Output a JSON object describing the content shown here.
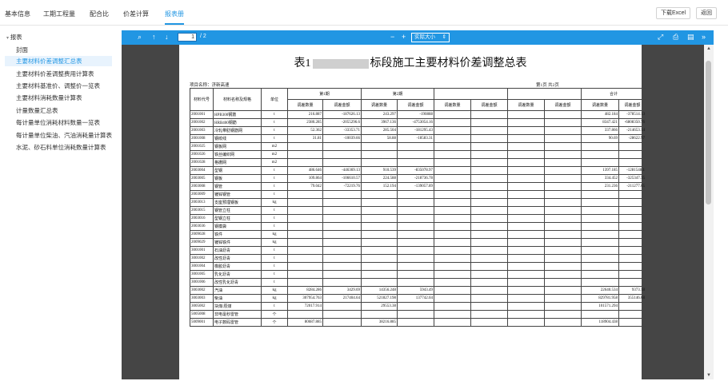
{
  "tabs": [
    {
      "label": "基本信息",
      "active": false
    },
    {
      "label": "工期工程量",
      "active": false
    },
    {
      "label": "配合比",
      "active": false
    },
    {
      "label": "价差计算",
      "active": false
    },
    {
      "label": "报表册",
      "active": true
    }
  ],
  "actions": {
    "download": "下载Excel",
    "back": "返回"
  },
  "sidebar": {
    "root": "报表",
    "items": [
      {
        "label": "封面"
      },
      {
        "label": "主要材料价差调整汇总表",
        "active": true
      },
      {
        "label": "主要材料价差调整费用计算表"
      },
      {
        "label": "主要材料基准价、调整价一览表"
      },
      {
        "label": "主要材料消耗数量计算表"
      },
      {
        "label": "计量数量汇总表"
      },
      {
        "label": "每计量单位消耗材料数量一览表"
      },
      {
        "label": "每计量单位柴油、汽油消耗量计算表"
      },
      {
        "label": "水泥、砂石料单位消耗数量计算表"
      }
    ]
  },
  "viewer": {
    "page_current": "1",
    "page_total": "/ 2",
    "zoom": "实际大小",
    "icons": {
      "search": "search-icon",
      "prev": "arrow-up-icon",
      "next": "arrow-down-icon",
      "zoom_out": "minus-icon",
      "zoom_in": "plus-icon",
      "fullscreen": "expand-icon",
      "print": "print-icon",
      "save": "document-icon",
      "more": "double-chevron-icon"
    }
  },
  "report": {
    "title_prefix": "表1",
    "title_suffix": "标段施工主要材料价差调整总表",
    "project": "项目名称：济新高速",
    "page_info": "第1页    共2页",
    "headers": {
      "code": "材料代号",
      "name": "材料名称及规格",
      "unit": "单位",
      "p1": "第1期",
      "p2": "第2期",
      "total": "合计",
      "qty": "调差数量",
      "amt": "调差金额"
    },
    "rows": [
      {
        "code": "2001001",
        "name": "HPB300钢筋",
        "unit": "t",
        "q1": "216.887",
        "a1": "-187626.13",
        "q2": "243.297",
        "a2": "-190888",
        "qt": "482.184",
        "at": "-378514.13"
      },
      {
        "code": "2001002",
        "name": "HRB400钢筋",
        "unit": "t",
        "q1": "2380.285",
        "a1": "-2055296.6",
        "q2": "3967.136",
        "a2": "-4753054.16",
        "qt": "8347.421",
        "at": "-6808350.76"
      },
      {
        "code": "2001003",
        "name": "冷轧带肋钢筋网",
        "unit": "t",
        "q1": "52.362",
        "a1": "-33353.71",
        "q2": "285.504",
        "a2": "-181295.43",
        "qt": "337.866",
        "at": "-214653.14"
      },
      {
        "code": "2001008",
        "name": "钢绞线",
        "unit": "t",
        "q1": "31.81",
        "a1": "-10039.66",
        "q2": "58.88",
        "a2": "-18583.31",
        "qt": "90.69",
        "at": "-28622.97"
      },
      {
        "code": "2001025",
        "name": "钢板网",
        "unit": "m2",
        "q1": "",
        "a1": "",
        "q2": "",
        "a2": "",
        "qt": "",
        "at": ""
      },
      {
        "code": "2001026",
        "name": "铁丝编织网",
        "unit": "m2",
        "q1": "",
        "a1": "",
        "q2": "",
        "a2": "",
        "qt": "",
        "at": ""
      },
      {
        "code": "2001028",
        "name": "格栅网",
        "unit": "m2",
        "q1": "",
        "a1": "",
        "q2": "",
        "a2": "",
        "qt": "",
        "at": ""
      },
      {
        "code": "2003004",
        "name": "型钢",
        "unit": "t",
        "q1": "486.646",
        "a1": "-446369.13",
        "q2": "910.539",
        "a2": "-835078.97",
        "qt": "1397.185",
        "at": "-1281548.1"
      },
      {
        "code": "2003005",
        "name": "钢板",
        "unit": "t",
        "q1": "109.864",
        "a1": "-106610.57",
        "q2": "224.588",
        "a2": "-218736.78",
        "qt": "334.452",
        "at": "-325347.35"
      },
      {
        "code": "2003008",
        "name": "钢管",
        "unit": "t",
        "q1": "79.042",
        "a1": "-72219.76",
        "q2": "152.194",
        "a2": "-139057.89",
        "qt": "231.236",
        "at": "-211277.65"
      },
      {
        "code": "2003009",
        "name": "镀锌钢管",
        "unit": "t",
        "q1": "",
        "a1": "",
        "q2": "",
        "a2": "",
        "qt": "",
        "at": ""
      },
      {
        "code": "2003013",
        "name": "支座预埋钢板",
        "unit": "kg",
        "q1": "",
        "a1": "",
        "q2": "",
        "a2": "",
        "qt": "",
        "at": ""
      },
      {
        "code": "2003015",
        "name": "钢管立柱",
        "unit": "t",
        "q1": "",
        "a1": "",
        "q2": "",
        "a2": "",
        "qt": "",
        "at": ""
      },
      {
        "code": "2003016",
        "name": "型钢立柱",
        "unit": "t",
        "q1": "",
        "a1": "",
        "q2": "",
        "a2": "",
        "qt": "",
        "at": ""
      },
      {
        "code": "2003036",
        "name": "钢模袋",
        "unit": "t",
        "q1": "",
        "a1": "",
        "q2": "",
        "a2": "",
        "qt": "",
        "at": ""
      },
      {
        "code": "2009028",
        "name": "铁件",
        "unit": "kg",
        "q1": "",
        "a1": "",
        "q2": "",
        "a2": "",
        "qt": "",
        "at": ""
      },
      {
        "code": "2009029",
        "name": "镀锌铁件",
        "unit": "kg",
        "q1": "",
        "a1": "",
        "q2": "",
        "a2": "",
        "qt": "",
        "at": ""
      },
      {
        "code": "3001001",
        "name": "石油沥青",
        "unit": "t",
        "q1": "",
        "a1": "",
        "q2": "",
        "a2": "",
        "qt": "",
        "at": ""
      },
      {
        "code": "3001002",
        "name": "改性沥青",
        "unit": "t",
        "q1": "",
        "a1": "",
        "q2": "",
        "a2": "",
        "qt": "",
        "at": ""
      },
      {
        "code": "3001004",
        "name": "橡胶沥青",
        "unit": "t",
        "q1": "",
        "a1": "",
        "q2": "",
        "a2": "",
        "qt": "",
        "at": ""
      },
      {
        "code": "3001005",
        "name": "乳化沥青",
        "unit": "t",
        "q1": "",
        "a1": "",
        "q2": "",
        "a2": "",
        "qt": "",
        "at": ""
      },
      {
        "code": "3001006",
        "name": "改性乳化沥青",
        "unit": "t",
        "q1": "",
        "a1": "",
        "q2": "",
        "a2": "",
        "qt": "",
        "at": ""
      },
      {
        "code": "3003002",
        "name": "汽油",
        "unit": "kg",
        "q1": "8284.286",
        "a1": "3429.69",
        "q2": "14356.248",
        "a2": "5943.49",
        "qt": "22640.534",
        "at": "9373.18"
      },
      {
        "code": "3003003",
        "name": "柴油",
        "unit": "kg",
        "q1": "307954.763",
        "a1": "217404.64",
        "q2": "521827.198",
        "a2": "137742.04",
        "qt": "829781.958",
        "at": "355146.68"
      },
      {
        "code": "3005002",
        "name": "块煤/原煤",
        "unit": "t",
        "q1": "72017.914",
        "a1": "",
        "q2": "29553.38",
        "a2": "",
        "qt": "101571.294",
        "at": ""
      },
      {
        "code": "5005008",
        "name": "非电毫秒雷管",
        "unit": "个",
        "q1": "",
        "a1": "",
        "q2": "",
        "a2": "",
        "qt": "",
        "at": ""
      },
      {
        "code": "5009001",
        "name": "电子数码雷管",
        "unit": "个",
        "q1": "80687.885",
        "a1": "",
        "q2": "38216.885",
        "a2": "",
        "qt": "118904.438",
        "at": ""
      }
    ]
  }
}
